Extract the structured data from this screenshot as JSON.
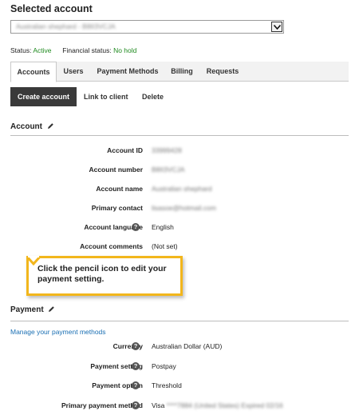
{
  "page": {
    "heading": "Selected account"
  },
  "account_select": {
    "value": "Australian shephard - B8II3VCJA"
  },
  "status_line": {
    "status_label": "Status:",
    "status_value": "Active",
    "financial_label": "Financial status:",
    "financial_value": "No hold"
  },
  "tabs": [
    {
      "label": "Accounts",
      "active": true
    },
    {
      "label": "Users",
      "active": false
    },
    {
      "label": "Payment Methods",
      "active": false
    },
    {
      "label": "Billing",
      "active": false
    },
    {
      "label": "Requests",
      "active": false
    }
  ],
  "actions": {
    "create": "Create account",
    "link": "Link to client",
    "delete": "Delete"
  },
  "account_section": {
    "title": "Account",
    "rows": [
      {
        "label": "Account ID",
        "value": "33999428",
        "help": false
      },
      {
        "label": "Account number",
        "value": "B8II3VCJA",
        "help": false
      },
      {
        "label": "Account name",
        "value": "Australian shephard",
        "help": false
      },
      {
        "label": "Primary contact",
        "value": "lisasoe@hotmail.com",
        "help": false
      },
      {
        "label": "Account language",
        "value": "English",
        "help": true
      },
      {
        "label": "Account comments",
        "value": "(Not set)",
        "help": false
      }
    ]
  },
  "callout": {
    "text": "Click the pencil icon to edit your payment setting."
  },
  "payment_section": {
    "title": "Payment",
    "manage_link": "Manage your payment methods",
    "rows": [
      {
        "label": "Currency",
        "value": "Australian Dollar (AUD)",
        "help": true
      },
      {
        "label": "Payment setting",
        "value": "Postpay",
        "help": true
      },
      {
        "label": "Payment option",
        "value": "Threshold",
        "help": true
      },
      {
        "label": "Primary payment method",
        "value_prefix": "Visa",
        "value_rest": "****7884 (United States) Expired 02/16",
        "help": true
      }
    ]
  },
  "colors": {
    "active_green": "#1f8a1f",
    "link_blue": "#1a6fb3",
    "callout_border": "#f2b61c",
    "primary_button": "#3a3a3a"
  }
}
